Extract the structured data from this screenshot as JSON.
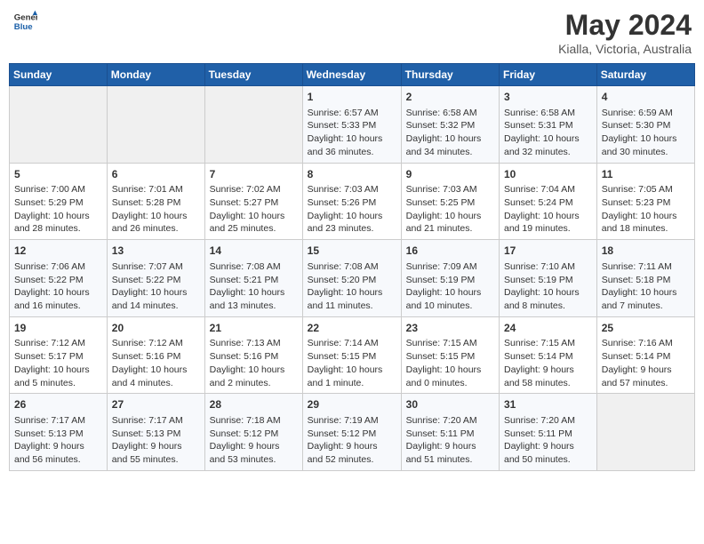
{
  "header": {
    "logo_line1": "General",
    "logo_line2": "Blue",
    "title": "May 2024",
    "location": "Kialla, Victoria, Australia"
  },
  "days_of_week": [
    "Sunday",
    "Monday",
    "Tuesday",
    "Wednesday",
    "Thursday",
    "Friday",
    "Saturday"
  ],
  "weeks": [
    [
      {
        "day": "",
        "content": ""
      },
      {
        "day": "",
        "content": ""
      },
      {
        "day": "",
        "content": ""
      },
      {
        "day": "1",
        "content": "Sunrise: 6:57 AM\nSunset: 5:33 PM\nDaylight: 10 hours\nand 36 minutes."
      },
      {
        "day": "2",
        "content": "Sunrise: 6:58 AM\nSunset: 5:32 PM\nDaylight: 10 hours\nand 34 minutes."
      },
      {
        "day": "3",
        "content": "Sunrise: 6:58 AM\nSunset: 5:31 PM\nDaylight: 10 hours\nand 32 minutes."
      },
      {
        "day": "4",
        "content": "Sunrise: 6:59 AM\nSunset: 5:30 PM\nDaylight: 10 hours\nand 30 minutes."
      }
    ],
    [
      {
        "day": "5",
        "content": "Sunrise: 7:00 AM\nSunset: 5:29 PM\nDaylight: 10 hours\nand 28 minutes."
      },
      {
        "day": "6",
        "content": "Sunrise: 7:01 AM\nSunset: 5:28 PM\nDaylight: 10 hours\nand 26 minutes."
      },
      {
        "day": "7",
        "content": "Sunrise: 7:02 AM\nSunset: 5:27 PM\nDaylight: 10 hours\nand 25 minutes."
      },
      {
        "day": "8",
        "content": "Sunrise: 7:03 AM\nSunset: 5:26 PM\nDaylight: 10 hours\nand 23 minutes."
      },
      {
        "day": "9",
        "content": "Sunrise: 7:03 AM\nSunset: 5:25 PM\nDaylight: 10 hours\nand 21 minutes."
      },
      {
        "day": "10",
        "content": "Sunrise: 7:04 AM\nSunset: 5:24 PM\nDaylight: 10 hours\nand 19 minutes."
      },
      {
        "day": "11",
        "content": "Sunrise: 7:05 AM\nSunset: 5:23 PM\nDaylight: 10 hours\nand 18 minutes."
      }
    ],
    [
      {
        "day": "12",
        "content": "Sunrise: 7:06 AM\nSunset: 5:22 PM\nDaylight: 10 hours\nand 16 minutes."
      },
      {
        "day": "13",
        "content": "Sunrise: 7:07 AM\nSunset: 5:22 PM\nDaylight: 10 hours\nand 14 minutes."
      },
      {
        "day": "14",
        "content": "Sunrise: 7:08 AM\nSunset: 5:21 PM\nDaylight: 10 hours\nand 13 minutes."
      },
      {
        "day": "15",
        "content": "Sunrise: 7:08 AM\nSunset: 5:20 PM\nDaylight: 10 hours\nand 11 minutes."
      },
      {
        "day": "16",
        "content": "Sunrise: 7:09 AM\nSunset: 5:19 PM\nDaylight: 10 hours\nand 10 minutes."
      },
      {
        "day": "17",
        "content": "Sunrise: 7:10 AM\nSunset: 5:19 PM\nDaylight: 10 hours\nand 8 minutes."
      },
      {
        "day": "18",
        "content": "Sunrise: 7:11 AM\nSunset: 5:18 PM\nDaylight: 10 hours\nand 7 minutes."
      }
    ],
    [
      {
        "day": "19",
        "content": "Sunrise: 7:12 AM\nSunset: 5:17 PM\nDaylight: 10 hours\nand 5 minutes."
      },
      {
        "day": "20",
        "content": "Sunrise: 7:12 AM\nSunset: 5:16 PM\nDaylight: 10 hours\nand 4 minutes."
      },
      {
        "day": "21",
        "content": "Sunrise: 7:13 AM\nSunset: 5:16 PM\nDaylight: 10 hours\nand 2 minutes."
      },
      {
        "day": "22",
        "content": "Sunrise: 7:14 AM\nSunset: 5:15 PM\nDaylight: 10 hours\nand 1 minute."
      },
      {
        "day": "23",
        "content": "Sunrise: 7:15 AM\nSunset: 5:15 PM\nDaylight: 10 hours\nand 0 minutes."
      },
      {
        "day": "24",
        "content": "Sunrise: 7:15 AM\nSunset: 5:14 PM\nDaylight: 9 hours\nand 58 minutes."
      },
      {
        "day": "25",
        "content": "Sunrise: 7:16 AM\nSunset: 5:14 PM\nDaylight: 9 hours\nand 57 minutes."
      }
    ],
    [
      {
        "day": "26",
        "content": "Sunrise: 7:17 AM\nSunset: 5:13 PM\nDaylight: 9 hours\nand 56 minutes."
      },
      {
        "day": "27",
        "content": "Sunrise: 7:17 AM\nSunset: 5:13 PM\nDaylight: 9 hours\nand 55 minutes."
      },
      {
        "day": "28",
        "content": "Sunrise: 7:18 AM\nSunset: 5:12 PM\nDaylight: 9 hours\nand 53 minutes."
      },
      {
        "day": "29",
        "content": "Sunrise: 7:19 AM\nSunset: 5:12 PM\nDaylight: 9 hours\nand 52 minutes."
      },
      {
        "day": "30",
        "content": "Sunrise: 7:20 AM\nSunset: 5:11 PM\nDaylight: 9 hours\nand 51 minutes."
      },
      {
        "day": "31",
        "content": "Sunrise: 7:20 AM\nSunset: 5:11 PM\nDaylight: 9 hours\nand 50 minutes."
      },
      {
        "day": "",
        "content": ""
      }
    ]
  ]
}
